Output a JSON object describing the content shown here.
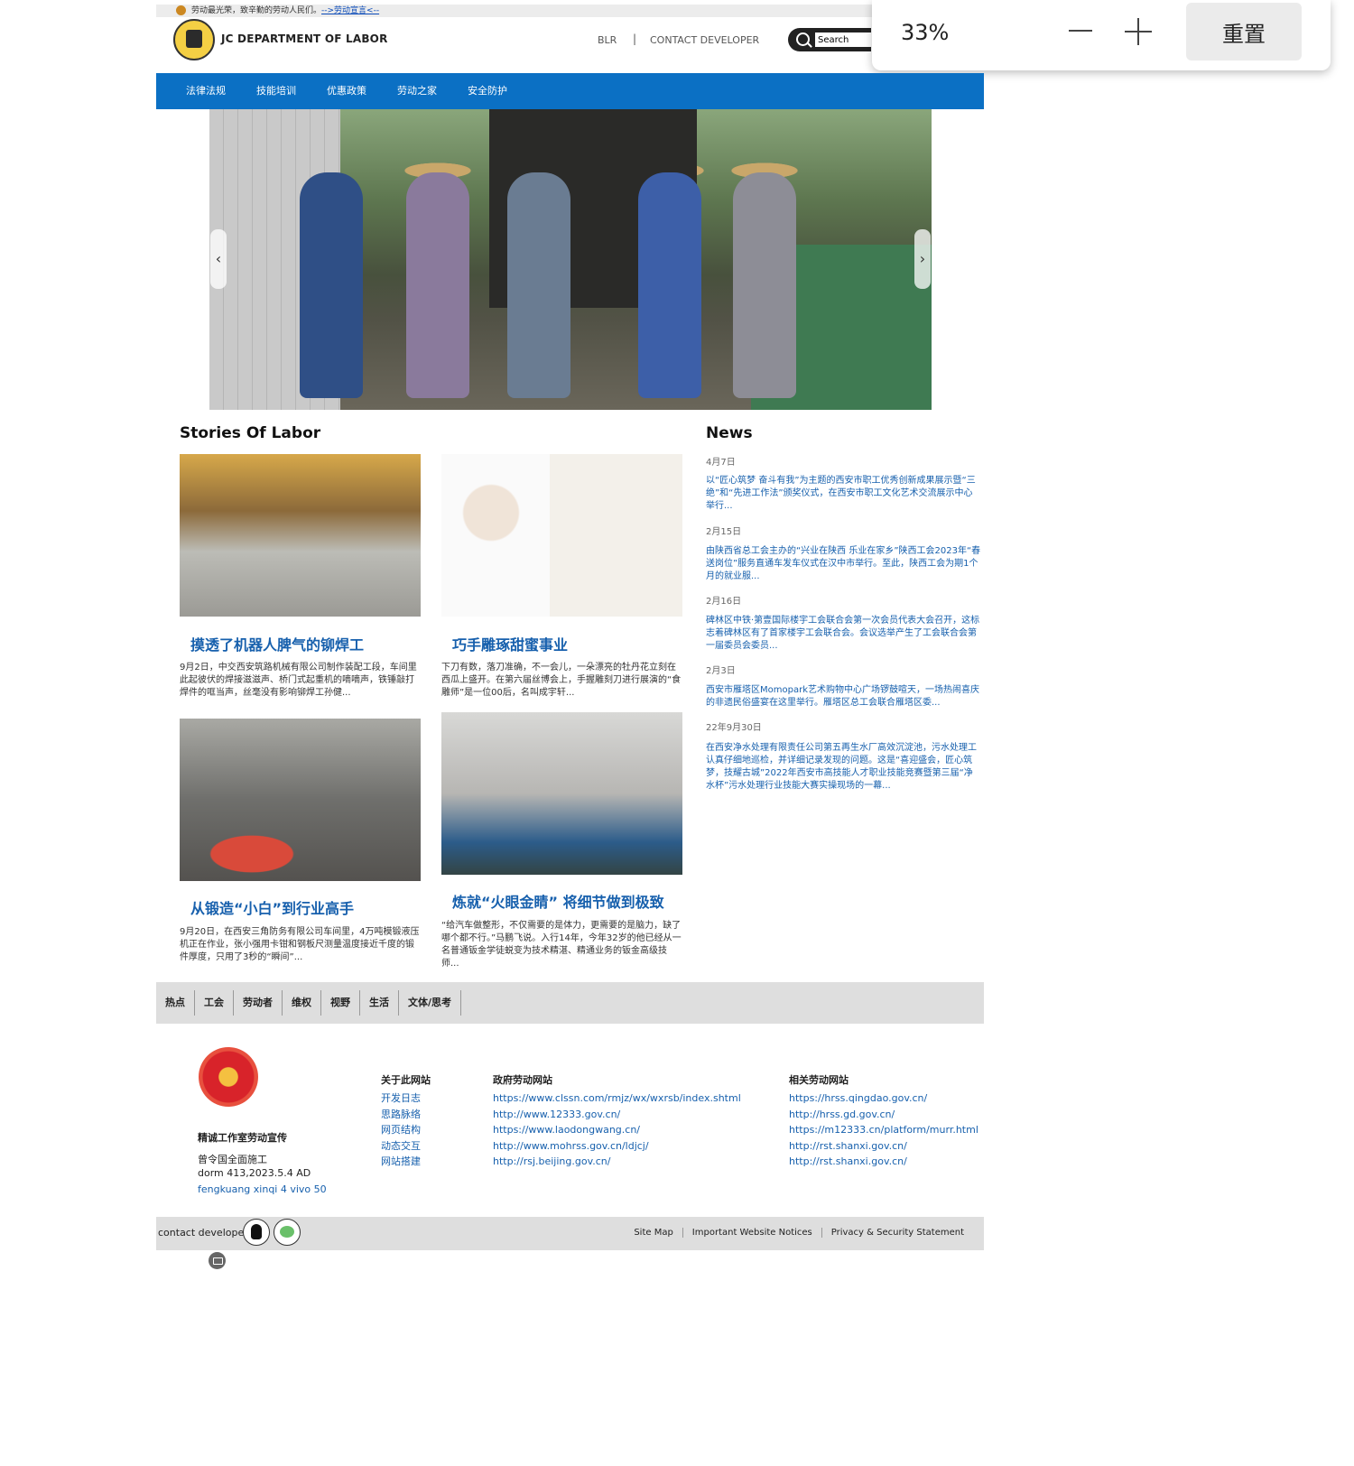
{
  "notice": {
    "text": "劳动最光荣，致辛勤的劳动人民们。",
    "link": "-->劳动宣言<--"
  },
  "header": {
    "site_title": "JC DEPARTMENT OF LABOR",
    "links": [
      "BLR",
      "CONTACT DEVELOPER"
    ],
    "separator": "|",
    "search_placeholder": "Search",
    "search_value": "Search"
  },
  "zoom_popup": {
    "percent": "33%",
    "reset_label": "重置"
  },
  "nav": {
    "items": [
      "法律法规",
      "技能培训",
      "优惠政策",
      "劳动之家",
      "安全防护"
    ]
  },
  "hero": {
    "prev": "‹",
    "next": "›"
  },
  "stories": {
    "title": "Stories Of Labor",
    "cards": [
      {
        "title": "摸透了机器人脾气的铆焊工",
        "desc": "9月2日，中交西安筑路机械有限公司制作装配工段，车间里此起彼伏的焊接滋滋声、桥门式起重机的嘀嘀声，铁锤敲打焊件的哐当声，丝毫没有影响铆焊工孙健..."
      },
      {
        "title": "巧手雕琢甜蜜事业",
        "desc": "下刀有数，落刀准确，不一会儿，一朵漂亮的牡丹花立刻在西瓜上盛开。在第六届丝博会上，手握雕刻刀进行展演的“食雕师”是一位00后，名叫成宇轩..."
      },
      {
        "title": "从锻造“小白”到行业高手",
        "desc": "9月20日，在西安三角防务有限公司车间里，4万吨模锻液压机正在作业，张小强用卡钳和钢板尺测量温度接近千度的锻件厚度，只用了3秒的“瞬间”..."
      },
      {
        "title": "炼就“火眼金睛” 将细节做到极致",
        "desc": "“给汽车做整形，不仅需要的是体力，更需要的是脑力，缺了哪个都不行。”马鹏飞说。入行14年，今年32岁的他已经从一名普通钣金学徒蜕变为技术精湛、精通业务的钣金高级技师..."
      }
    ]
  },
  "news": {
    "title": "News",
    "items": [
      {
        "date": "4月7日",
        "text": "以“匠心筑梦 奋斗有我”为主题的西安市职工优秀创新成果展示暨“三绝”和“先进工作法”颁奖仪式，在西安市职工文化艺术交流展示中心举行..."
      },
      {
        "date": "2月15日",
        "text": "由陕西省总工会主办的“兴业在陕西 乐业在家乡”陕西工会2023年“春送岗位”服务直通车发车仪式在汉中市举行。至此，陕西工会为期1个月的就业服..."
      },
      {
        "date": "2月16日",
        "text": "碑林区中铁·第壹国际楼宇工会联合会第一次会员代表大会召开，这标志着碑林区有了首家楼宇工会联合会。会议选举产生了工会联合会第一届委员会委员..."
      },
      {
        "date": "2月3日",
        "text": "西安市雁塔区Momopark艺术购物中心广场锣鼓喧天，一场热闹喜庆的非遗民俗盛宴在这里举行。雁塔区总工会联合雁塔区委..."
      },
      {
        "date": "22年9月30日",
        "text": "在西安净水处理有限责任公司第五再生水厂高效沉淀池，污水处理工认真仔细地巡检，并详细记录发现的问题。这是“喜迎盛会，匠心筑梦，技耀古城”2022年西安市高技能人才职业技能竞赛暨第三届“净水杯”污水处理行业技能大赛实操现场的一幕..."
      }
    ]
  },
  "categories": [
    "热点",
    "工会",
    "劳动者",
    "维权",
    "视野",
    "生活",
    "文体/思考"
  ],
  "footer": {
    "org_name": "精诚工作室劳动宣传",
    "line1": "曾令国全面施工",
    "line2": "dorm 413,2023.5.4 AD",
    "line3": "fengkuang xinqi 4 vivo 50",
    "about": {
      "title": "关于此网站",
      "links": [
        "开发日志",
        "思路脉络",
        "网页结构",
        "动态交互",
        "网站搭建"
      ]
    },
    "gov": {
      "title": "政府劳动网站",
      "links": [
        "https://www.clssn.com/rmjz/wx/wxrsb/index.shtml",
        "http://www.12333.gov.cn/",
        "https://www.laodongwang.cn/",
        "http://www.mohrss.gov.cn/ldjcj/",
        "http://rsj.beijing.gov.cn/"
      ]
    },
    "related": {
      "title": "相关劳动网站",
      "links": [
        "https://hrss.qingdao.gov.cn/",
        "http://hrss.gd.gov.cn/",
        "https://m12333.cn/platform/murr.html",
        "http://rst.shanxi.gov.cn/",
        "http://rst.shanxi.gov.cn/"
      ]
    },
    "contact_label": "contact developer",
    "bottom_links": [
      "Site Map",
      "Important Website Notices",
      "Privacy & Security Statement"
    ]
  }
}
